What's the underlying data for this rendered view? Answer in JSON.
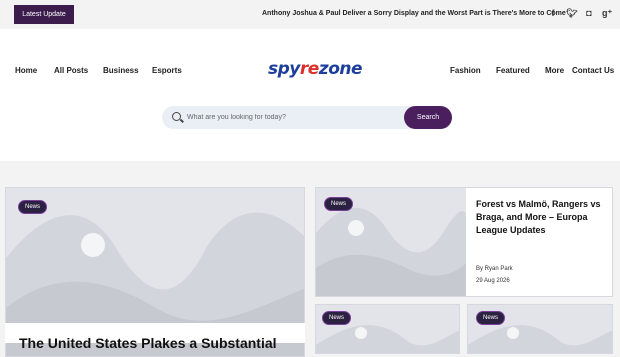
{
  "topbar": {
    "latest_label": "Latest Update",
    "ticker": "Anthony Joshua & Paul Deliver a Sorry Display and the Worst Part is There's More to Come",
    "socials": [
      "f",
      "t",
      "ig",
      "g+"
    ]
  },
  "nav": {
    "left": [
      "Home",
      "All Posts",
      "Business",
      "Esports"
    ],
    "right": [
      "Fashion",
      "Featured",
      "More",
      "Contact Us"
    ]
  },
  "logo": {
    "part1": "spy",
    "part2": "re",
    "part3": "zone"
  },
  "search": {
    "placeholder": "What are you looking for today?",
    "button": "Search"
  },
  "featured": {
    "badge": "News",
    "title": "The United States Plakes a Substantial"
  },
  "side_card": {
    "badge": "News",
    "title": "Forest vs Malmö, Rangers vs Braga, and More – Europa League Updates",
    "author": "By Ryan Park",
    "date": "29 Aug 2026"
  },
  "small_cards": [
    {
      "badge": "News"
    },
    {
      "badge": "News"
    }
  ]
}
